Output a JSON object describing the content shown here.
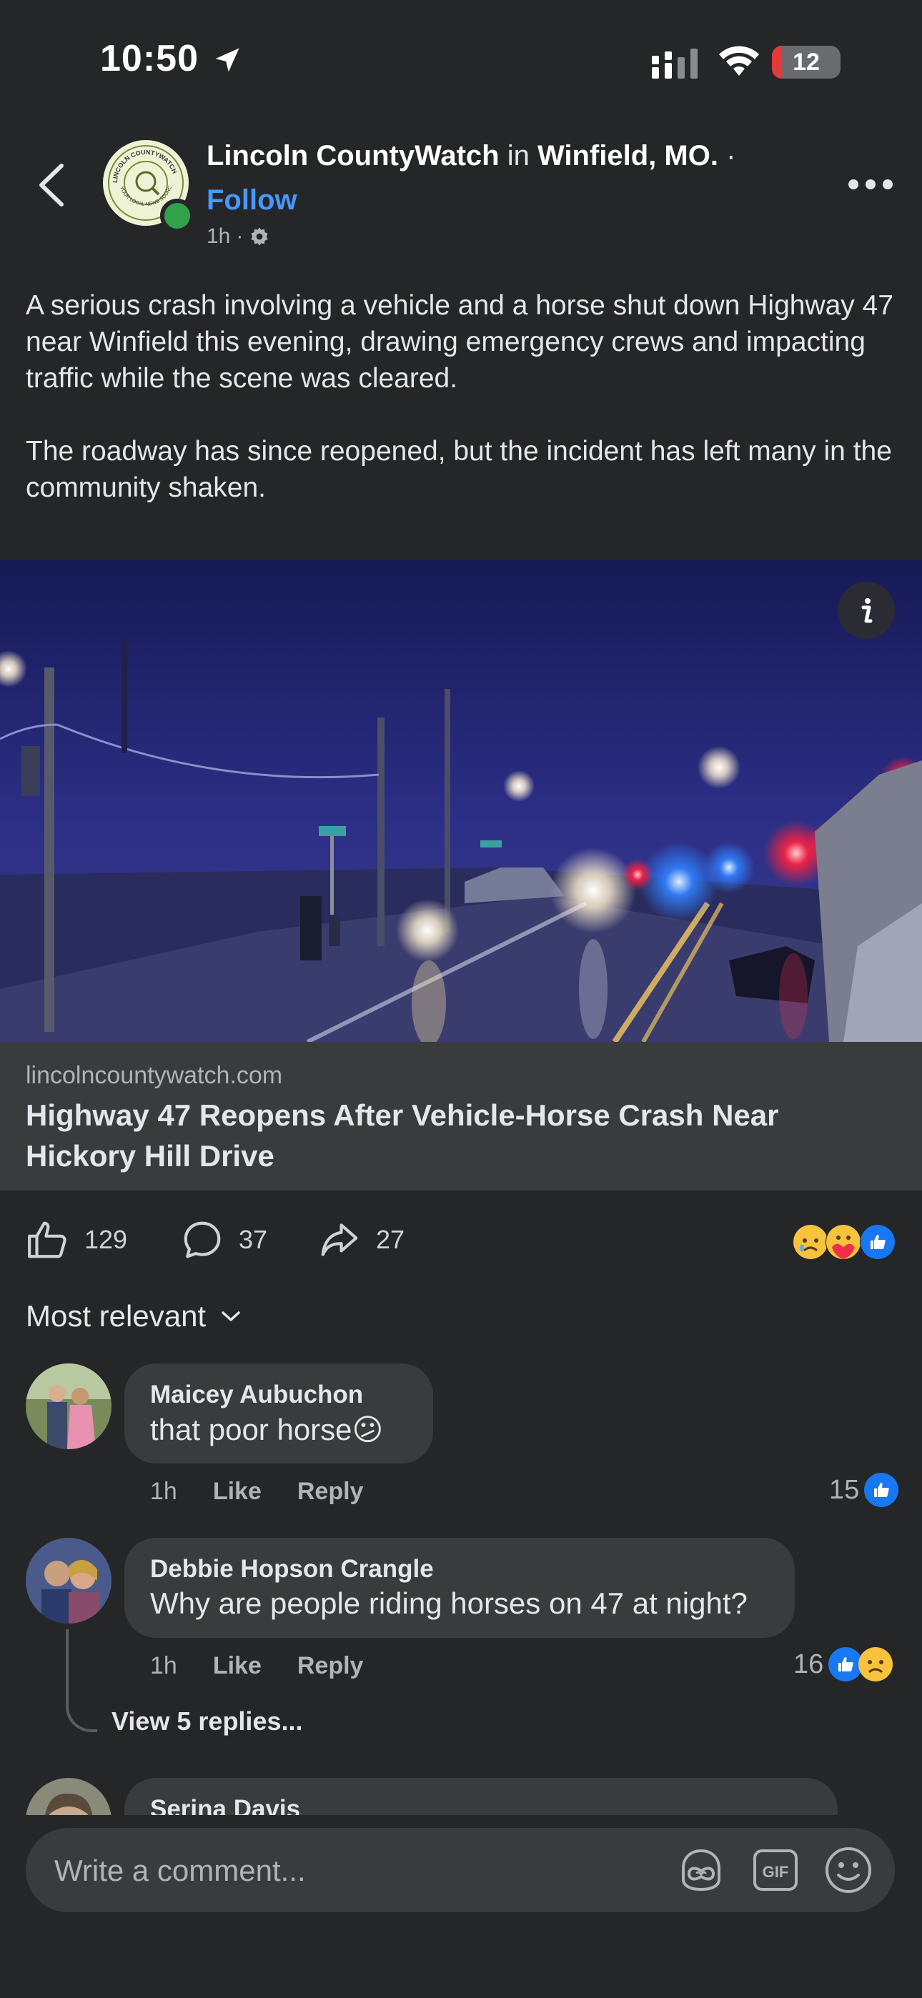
{
  "status_bar": {
    "time": "10:50",
    "battery": "12"
  },
  "post": {
    "page_name": "Lincoln CountyWatch",
    "in_word": "in",
    "location": "Winfield, MO.",
    "separator": "·",
    "follow_label": "Follow",
    "time": "1h",
    "paragraphs": [
      "A serious crash involving a vehicle and a horse shut down Highway 47 near Winfield this evening, drawing emergency crews and impacting traffic while the scene was cleared.",
      "The roadway has since reopened, but the incident has left many in the community shaken."
    ],
    "avatar_text": "LINCOLN COUNTYWATCH · YOUR LOCAL NEWS SOURCE"
  },
  "link_card": {
    "domain": "lincolncountywatch.com",
    "title": "Highway 47 Reopens After Vehicle-Horse Crash Near Hickory Hill Drive"
  },
  "actions": {
    "likes": "129",
    "comments": "37",
    "shares": "27"
  },
  "sort_label": "Most relevant",
  "comments": [
    {
      "name": "Maicey Aubuchon",
      "text": "that poor horse",
      "emoji": "😕",
      "time": "1h",
      "like": "Like",
      "reply": "Reply",
      "count": "15"
    },
    {
      "name": "Debbie Hopson Crangle",
      "text": "Why are people riding horses on 47 at night?",
      "time": "1h",
      "like": "Like",
      "reply": "Reply",
      "count": "16",
      "view_replies": "View 5 replies..."
    },
    {
      "name": "Serina Davis"
    }
  ],
  "composer": {
    "placeholder": "Write a comment..."
  },
  "colors": {
    "background": "#252628",
    "bubble": "#3a3b3c",
    "accent": "#4599ff",
    "online": "#31a24c"
  }
}
